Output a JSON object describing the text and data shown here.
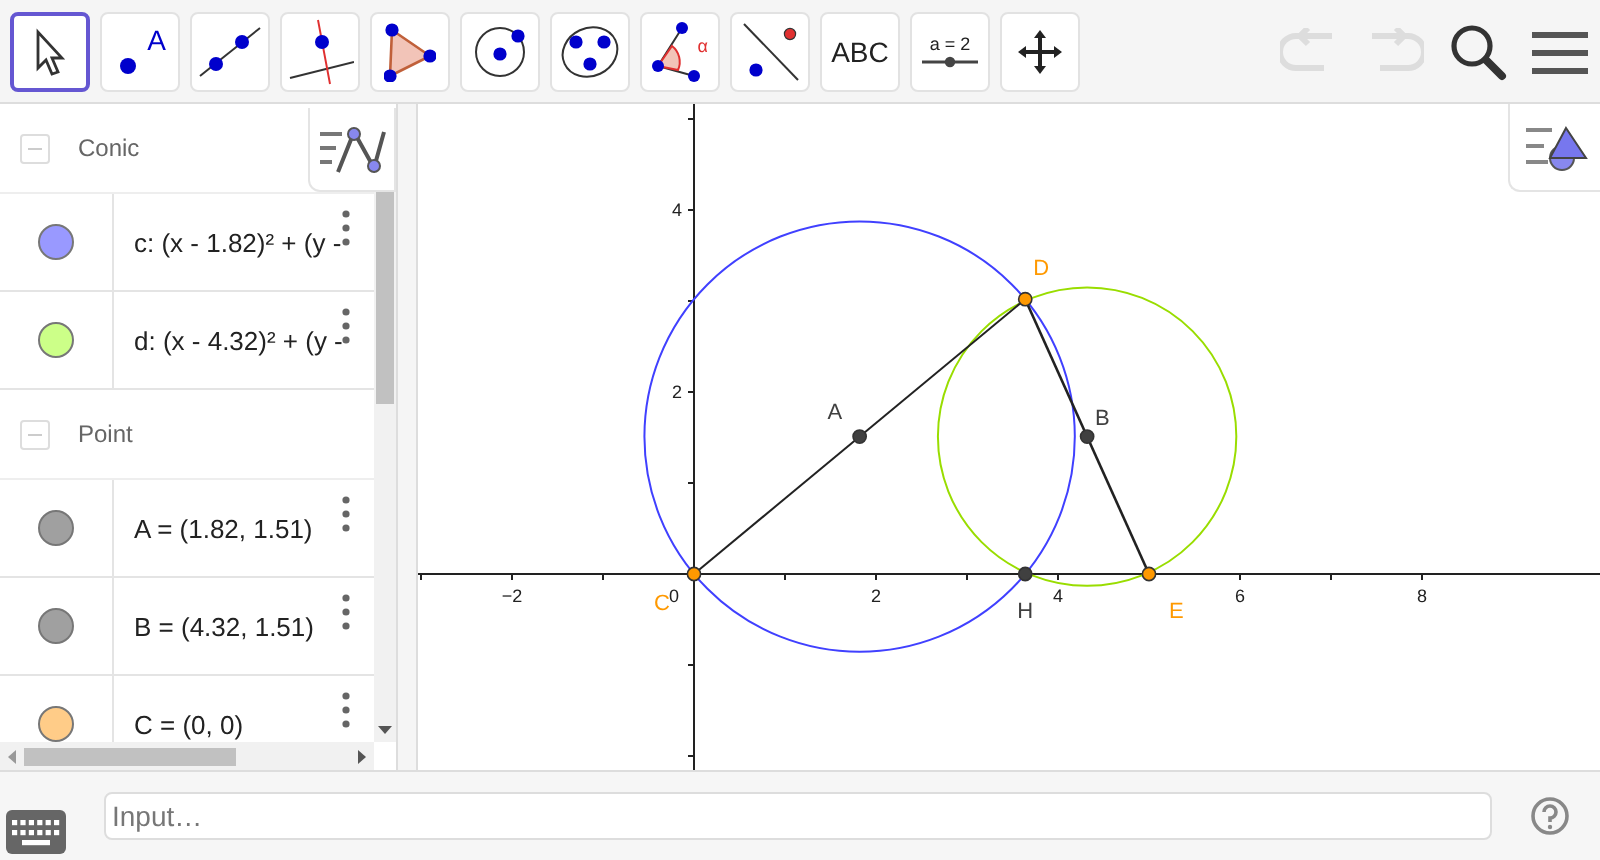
{
  "toolbar": {
    "tools": [
      {
        "kind": "pointer",
        "selected": true
      },
      {
        "kind": "point",
        "label": "A",
        "selected": false
      },
      {
        "kind": "line",
        "selected": false
      },
      {
        "kind": "perpendicular",
        "selected": false
      },
      {
        "kind": "polygon",
        "selected": false
      },
      {
        "kind": "circle",
        "selected": false
      },
      {
        "kind": "conic",
        "selected": false
      },
      {
        "kind": "angle",
        "label": "α",
        "selected": false
      },
      {
        "kind": "reflect",
        "selected": false
      },
      {
        "kind": "text",
        "label": "ABC",
        "selected": false
      },
      {
        "kind": "slider",
        "label": "a = 2",
        "selected": false
      },
      {
        "kind": "move",
        "selected": false
      }
    ],
    "undo": {
      "disabled": true
    },
    "redo": {
      "disabled": true
    }
  },
  "algebra": {
    "groups": [
      {
        "title": "Conic",
        "expanded": true,
        "items": [
          {
            "text": "c: (x - 1.82)² + (y -",
            "color": "#9999ff"
          },
          {
            "text": "d: (x - 4.32)² + (y -",
            "color": "#ccff88"
          }
        ]
      },
      {
        "title": "Point",
        "expanded": true,
        "items": [
          {
            "text": "A = (1.82, 1.51)",
            "color": "#a0a0a0"
          },
          {
            "text": "B = (4.32, 1.51)",
            "color": "#a0a0a0"
          },
          {
            "text": "C = (0, 0)",
            "color": "#ffcc88"
          }
        ]
      }
    ]
  },
  "graphics": {
    "x_ticks": [
      "−2",
      "0",
      "2",
      "4",
      "6",
      "8"
    ],
    "y_ticks": [
      "4",
      "2"
    ],
    "circles": [
      {
        "color": "#4040ff"
      },
      {
        "color": "#99dd00"
      }
    ],
    "points": [
      {
        "label": "D",
        "color": "#ff9900"
      },
      {
        "label": "A",
        "color": "#404040"
      },
      {
        "label": "B",
        "color": "#404040"
      },
      {
        "label": "C",
        "color": "#ff9900"
      },
      {
        "label": "H",
        "color": "#404040"
      },
      {
        "label": "E",
        "color": "#ff9900"
      }
    ]
  },
  "input": {
    "placeholder": "Input…"
  }
}
